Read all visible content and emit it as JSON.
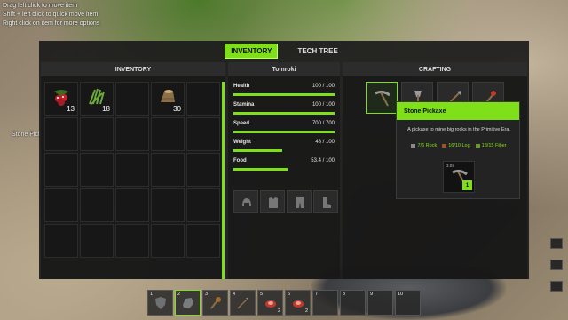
{
  "hints": {
    "line1": "Drag left click to move item",
    "line2": "Shift + left click to quick move item",
    "line3": "Right click on item for more options"
  },
  "world_label": "Stone Pick",
  "tabs": [
    {
      "label": "INVENTORY",
      "active": true
    },
    {
      "label": "TECH TREE",
      "active": false
    }
  ],
  "inventory": {
    "title": "INVENTORY",
    "slots": [
      {
        "item": "berries",
        "qty": "13"
      },
      {
        "item": "fiber",
        "qty": "18"
      },
      {
        "item": "empty",
        "qty": ""
      },
      {
        "item": "log",
        "qty": "30"
      }
    ]
  },
  "character": {
    "name": "Tomroki",
    "stats": [
      {
        "label": "Health",
        "value": "100 / 100",
        "fraction": 1.0
      },
      {
        "label": "Stamina",
        "value": "100 / 100",
        "fraction": 1.0
      },
      {
        "label": "Speed",
        "value": "700 / 700",
        "fraction": 1.0
      },
      {
        "label": "Weight",
        "value": "48 / 100",
        "fraction": 0.48
      },
      {
        "label": "Food",
        "value": "53.4 / 100",
        "fraction": 0.534
      }
    ],
    "equipment": [
      "helmet-icon",
      "chest-armor-icon",
      "pants-icon",
      "boots-icon"
    ]
  },
  "crafting": {
    "title": "CRAFTING",
    "recipes": [
      "stone-pickaxe-icon",
      "stone-axe-icon",
      "stone-spear-icon",
      "torch-icon"
    ],
    "tooltip": {
      "title": "Stone Pickaxe",
      "description": "A pickaxe to mine big rocks in the Primitive Era.",
      "costs": [
        {
          "text": "7/6 Rock",
          "color": "#8a8a8a"
        },
        {
          "text": "16/10 Log",
          "color": "#a0522d"
        },
        {
          "text": "18/15 Fiber",
          "color": "#6b9a2f"
        }
      ],
      "craft_time": "3.0S",
      "craft_amount": "1"
    }
  },
  "hotbar": [
    {
      "num": "1",
      "item": "shield-icon",
      "count": ""
    },
    {
      "num": "2",
      "item": "rock-icon",
      "count": "",
      "active": true
    },
    {
      "num": "3",
      "item": "torch-icon",
      "count": ""
    },
    {
      "num": "4",
      "item": "spear-icon",
      "count": ""
    },
    {
      "num": "5",
      "item": "raw-meat-icon",
      "count": "2"
    },
    {
      "num": "6",
      "item": "raw-meat-icon",
      "count": "2"
    },
    {
      "num": "7",
      "item": "empty",
      "count": ""
    },
    {
      "num": "8",
      "item": "empty",
      "count": ""
    },
    {
      "num": "9",
      "item": "empty",
      "count": ""
    },
    {
      "num": "10",
      "item": "empty",
      "count": ""
    }
  ],
  "colors": {
    "accent": "#7fe01a",
    "panel": "#1c1c1c"
  }
}
